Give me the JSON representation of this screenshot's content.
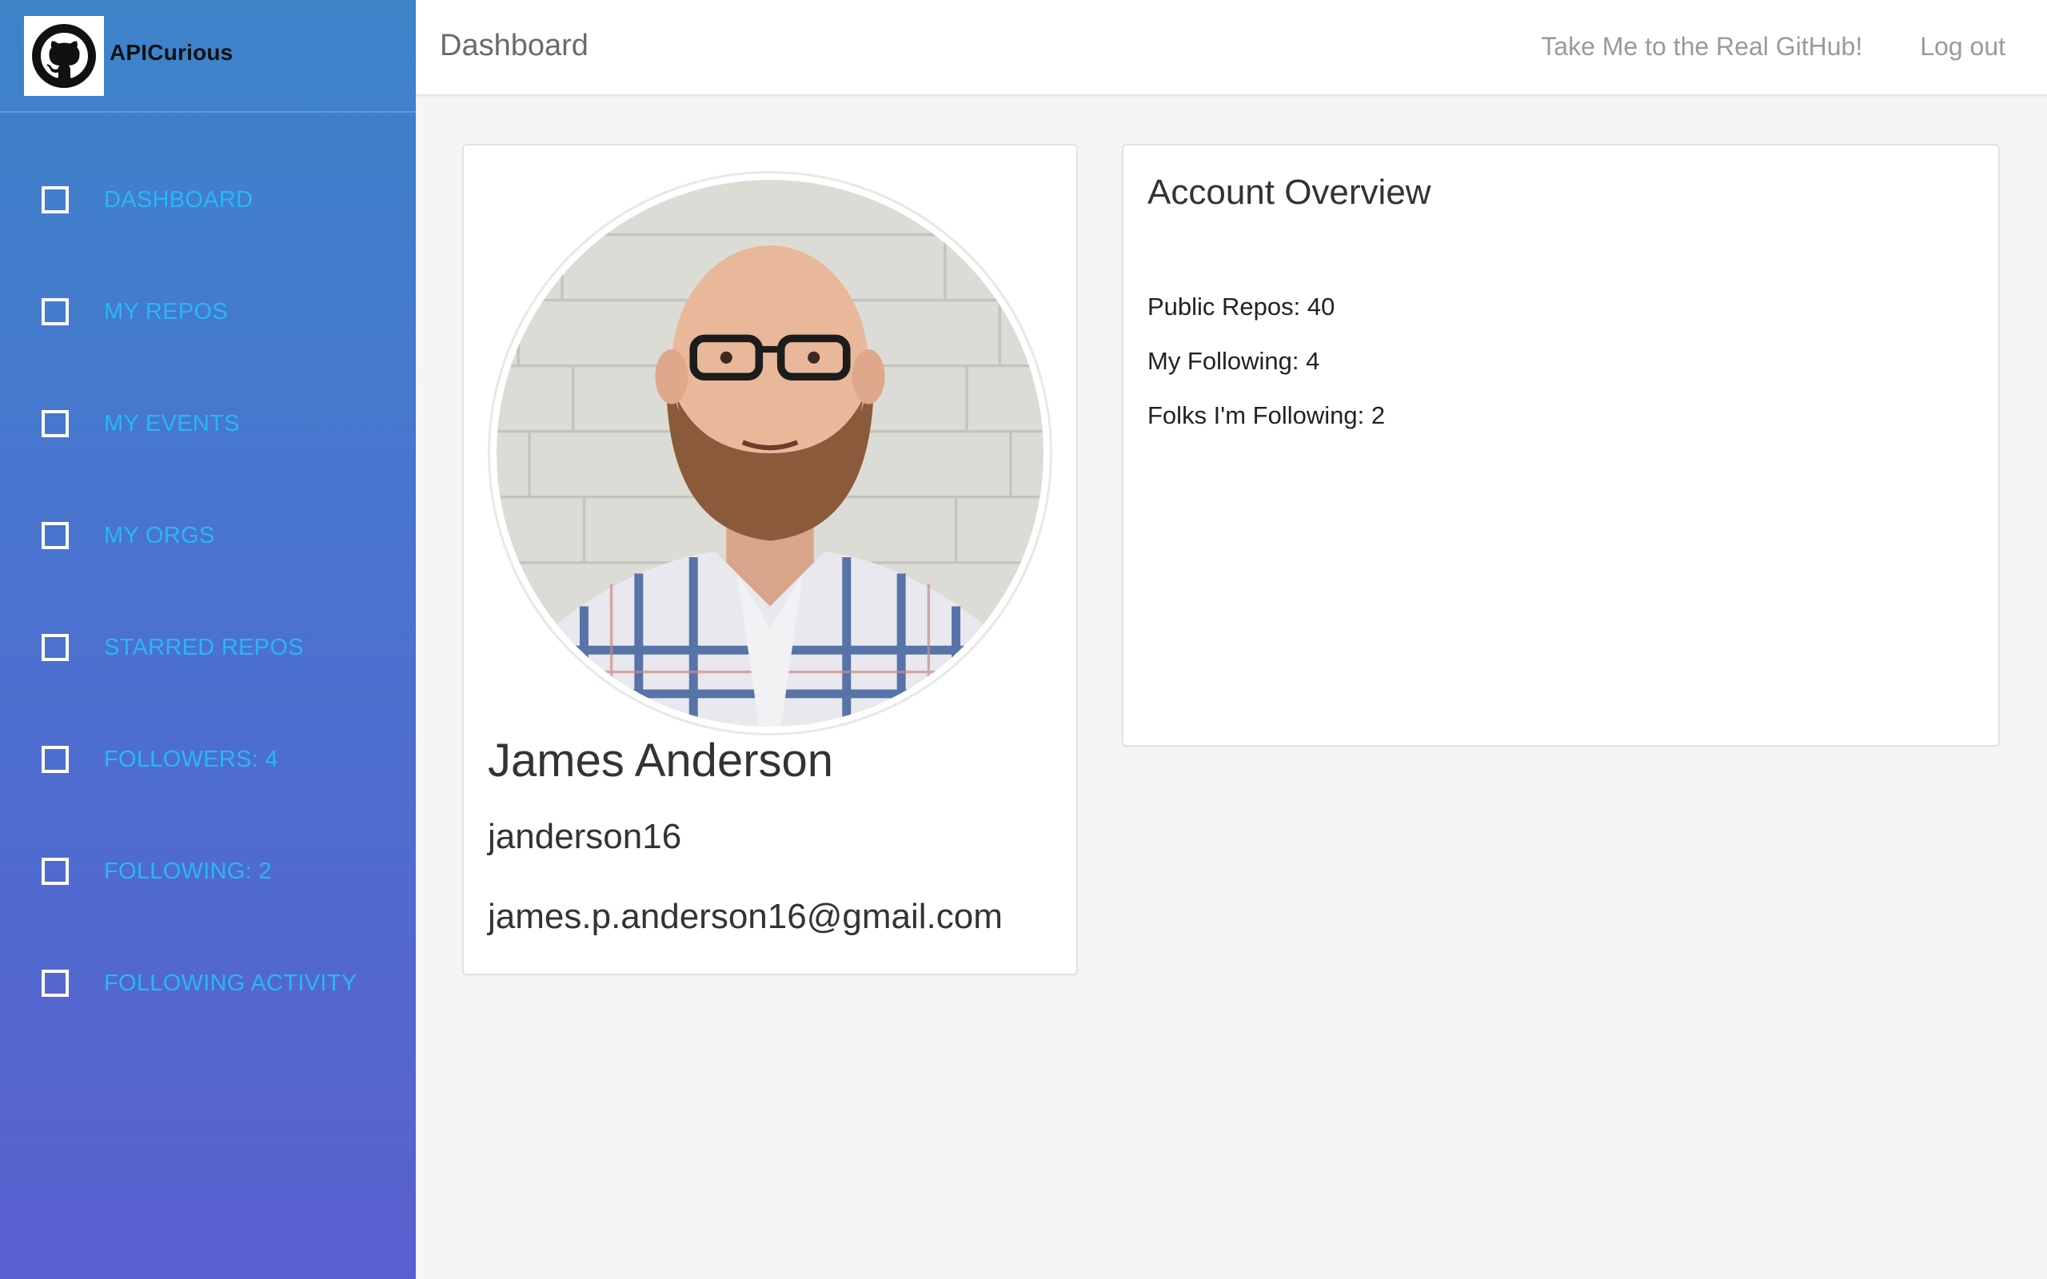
{
  "brand": {
    "name": "APICurious",
    "logo_icon": "github-octocat-icon"
  },
  "sidebar": {
    "items": [
      {
        "label": "Dashboard"
      },
      {
        "label": "My Repos"
      },
      {
        "label": "My Events"
      },
      {
        "label": "My Orgs"
      },
      {
        "label": "Starred Repos"
      },
      {
        "label": "Followers: 4"
      },
      {
        "label": "Following: 2"
      },
      {
        "label": "Following Activity"
      }
    ]
  },
  "header": {
    "title": "Dashboard",
    "links": [
      {
        "label": "Take Me to the Real GitHub!"
      },
      {
        "label": "Log out"
      }
    ]
  },
  "profile": {
    "name": "James Anderson",
    "login": "janderson16",
    "email": "james.p.anderson16@gmail.com"
  },
  "overview": {
    "title": "Account Overview",
    "stats": [
      {
        "text": "Public Repos: 40"
      },
      {
        "text": "My Following: 4"
      },
      {
        "text": "Folks I'm Following: 2"
      }
    ]
  },
  "colors": {
    "sidebar_top": "#3d84c9",
    "sidebar_bottom": "#5a5fcf",
    "nav_label": "#29b6f6",
    "background": "#f5f5f5"
  }
}
